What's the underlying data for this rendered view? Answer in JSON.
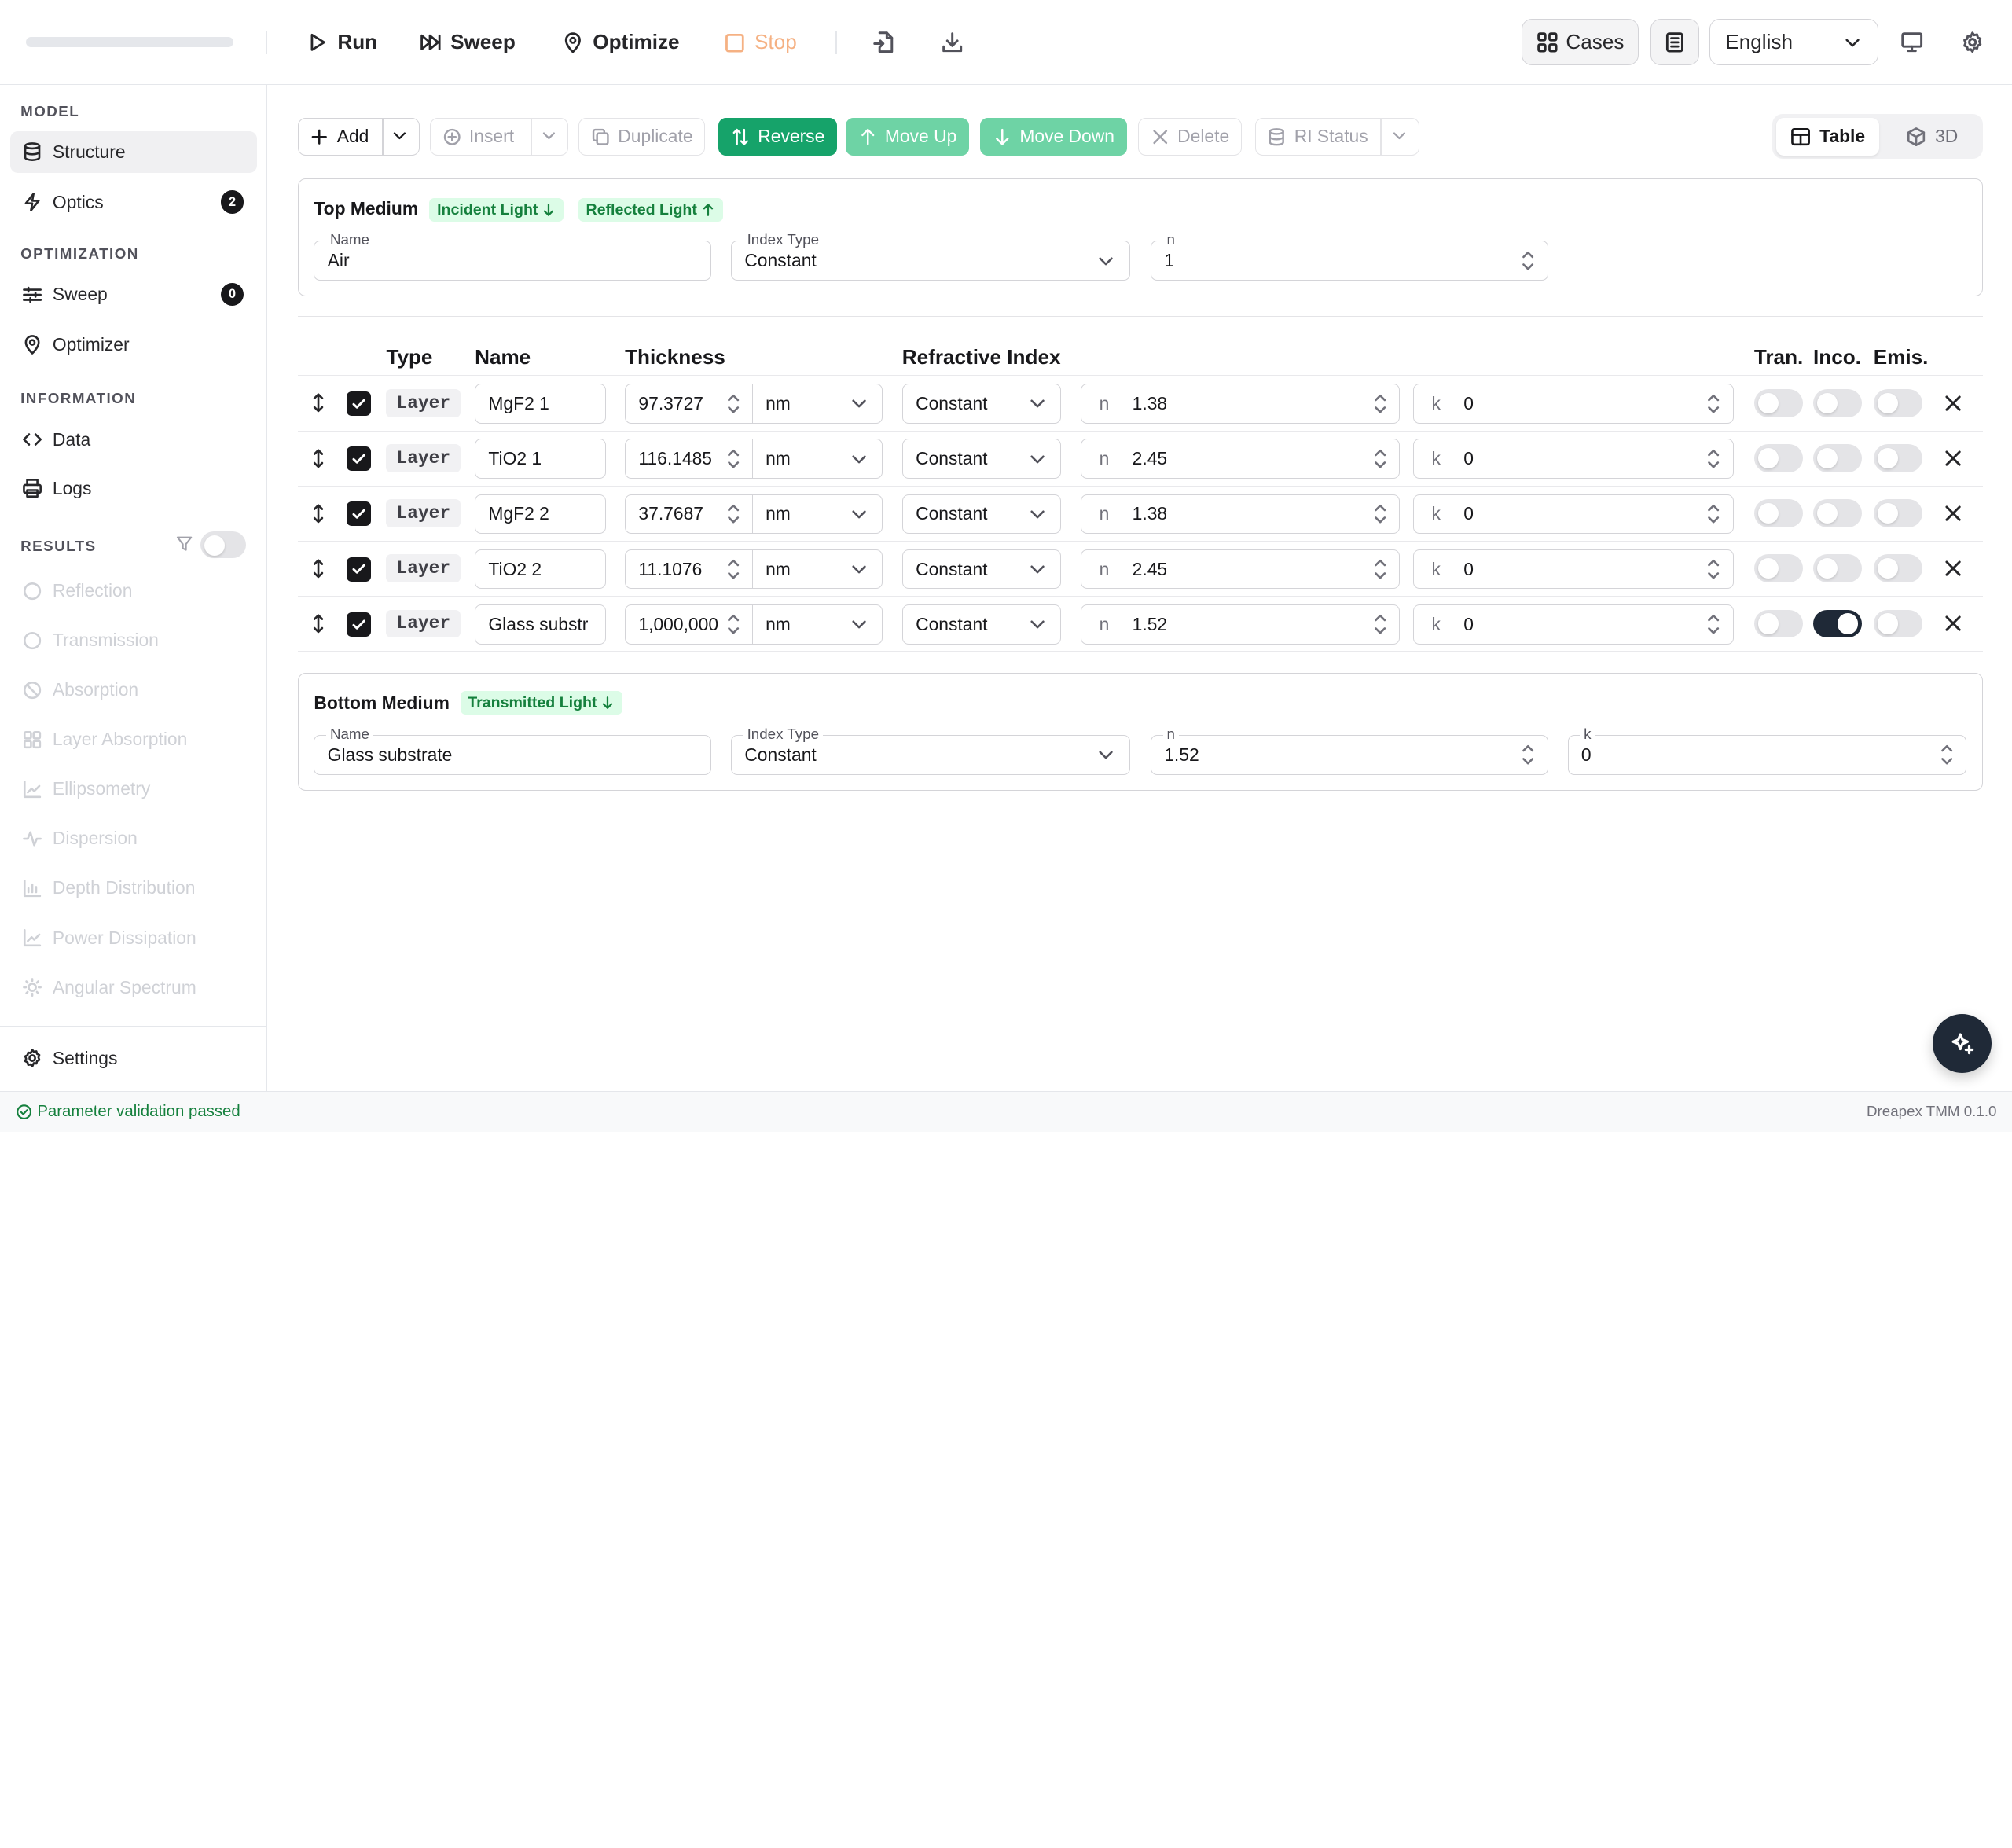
{
  "toolbar": {
    "run_label": "Run",
    "sweep_label": "Sweep",
    "optimize_label": "Optimize",
    "stop_label": "Stop",
    "cases_label": "Cases",
    "language": "English"
  },
  "sidebar": {
    "model_heading": "MODEL",
    "structure_label": "Structure",
    "optics_label": "Optics",
    "optics_count": "2",
    "optimization_heading": "OPTIMIZATION",
    "sweep_label": "Sweep",
    "sweep_count": "0",
    "optimizer_label": "Optimizer",
    "information_heading": "INFORMATION",
    "data_label": "Data",
    "logs_label": "Logs",
    "results_heading": "RESULTS",
    "results": [
      {
        "label": "Reflection",
        "icon": "circle-icon"
      },
      {
        "label": "Transmission",
        "icon": "circle-icon"
      },
      {
        "label": "Absorption",
        "icon": "ban-icon"
      },
      {
        "label": "Layer Absorption",
        "icon": "grid-icon"
      },
      {
        "label": "Ellipsometry",
        "icon": "chart-line-icon"
      },
      {
        "label": "Dispersion",
        "icon": "activity-icon"
      },
      {
        "label": "Depth Distribution",
        "icon": "bar-chart-icon"
      },
      {
        "label": "Power Dissipation",
        "icon": "chart-line-icon"
      },
      {
        "label": "Angular Spectrum",
        "icon": "sun-icon"
      }
    ],
    "settings_label": "Settings"
  },
  "actions": {
    "add": "Add",
    "insert": "Insert",
    "duplicate": "Duplicate",
    "reverse": "Reverse",
    "move_up": "Move Up",
    "move_down": "Move Down",
    "delete": "Delete",
    "ri_status": "RI Status",
    "view_table": "Table",
    "view_3d": "3D"
  },
  "top_medium": {
    "title": "Top Medium",
    "incident_pill": "Incident Light",
    "reflected_pill": "Reflected Light",
    "name_label": "Name",
    "name_value": "Air",
    "index_type_label": "Index Type",
    "index_type_value": "Constant",
    "n_label": "n",
    "n_value": "1"
  },
  "table": {
    "headers": {
      "type": "Type",
      "name": "Name",
      "thickness": "Thickness",
      "refractive_index": "Refractive Index",
      "tran": "Tran.",
      "inco": "Inco.",
      "emis": "Emis."
    },
    "n_prefix": "n",
    "k_prefix": "k",
    "rows": [
      {
        "type": "Layer",
        "name": "MgF2 1",
        "thickness": "97.3727",
        "unit": "nm",
        "index_type": "Constant",
        "n": "1.38",
        "k": "0",
        "tran": false,
        "inco": false,
        "emis": false
      },
      {
        "type": "Layer",
        "name": "TiO2 1",
        "thickness": "116.1485",
        "unit": "nm",
        "index_type": "Constant",
        "n": "2.45",
        "k": "0",
        "tran": false,
        "inco": false,
        "emis": false
      },
      {
        "type": "Layer",
        "name": "MgF2 2",
        "thickness": "37.7687",
        "unit": "nm",
        "index_type": "Constant",
        "n": "1.38",
        "k": "0",
        "tran": false,
        "inco": false,
        "emis": false
      },
      {
        "type": "Layer",
        "name": "TiO2 2",
        "thickness": "11.1076",
        "unit": "nm",
        "index_type": "Constant",
        "n": "2.45",
        "k": "0",
        "tran": false,
        "inco": false,
        "emis": false
      },
      {
        "type": "Layer",
        "name": "Glass substr",
        "thickness": "1,000,000",
        "unit": "nm",
        "index_type": "Constant",
        "n": "1.52",
        "k": "0",
        "tran": false,
        "inco": true,
        "emis": false
      }
    ]
  },
  "bottom_medium": {
    "title": "Bottom Medium",
    "transmitted_pill": "Transmitted Light",
    "name_label": "Name",
    "name_value": "Glass substrate",
    "index_type_label": "Index Type",
    "index_type_value": "Constant",
    "n_label": "n",
    "n_value": "1.52",
    "k_label": "k",
    "k_value": "0"
  },
  "status": {
    "message": "Parameter validation passed",
    "version": "Dreapex TMM 0.1.0"
  },
  "colors": {
    "accent_green": "#16a36a",
    "accent_green_light": "#6ed3a5",
    "stop_orange": "#f5b183",
    "pill_bg": "#dcfce7",
    "pill_text": "#15803d",
    "dark": "#18181b"
  }
}
